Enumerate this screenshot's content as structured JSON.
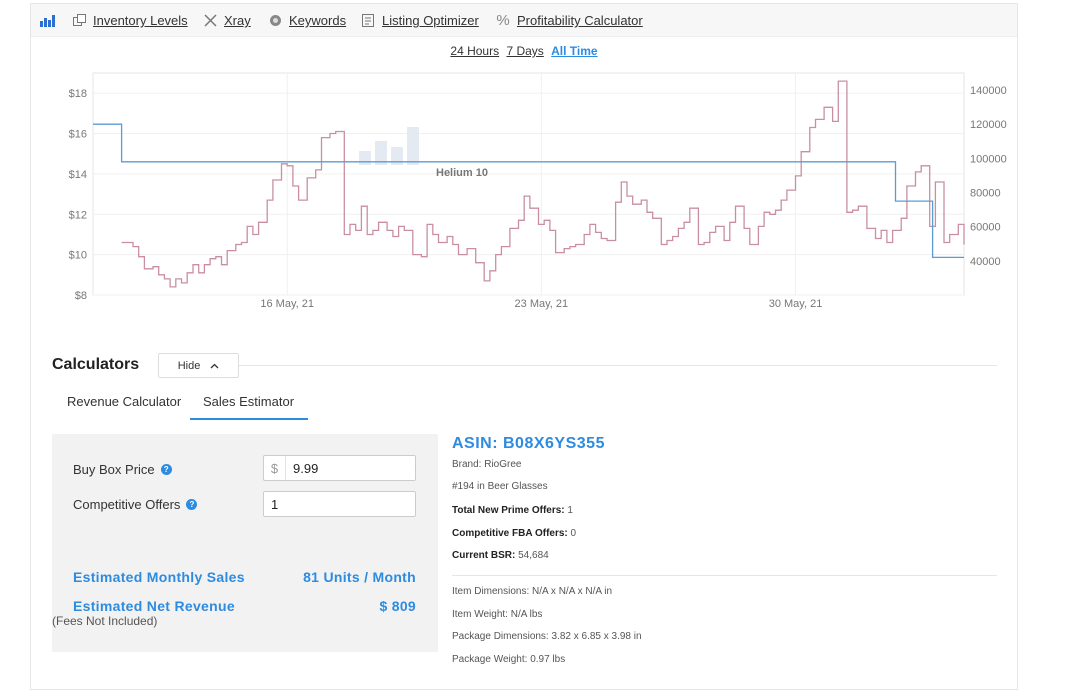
{
  "toolbar": {
    "items": [
      {
        "icon": "bar-chart-icon",
        "label": ""
      },
      {
        "icon": "inventory-icon",
        "label": "Inventory Levels"
      },
      {
        "icon": "xray-icon",
        "label": "Xray"
      },
      {
        "icon": "keywords-icon",
        "label": "Keywords"
      },
      {
        "icon": "listing-optimizer-icon",
        "label": "Listing Optimizer"
      },
      {
        "icon": "percent-icon",
        "label": "Profitability Calculator"
      }
    ]
  },
  "range": {
    "options": [
      "24 Hours",
      "7 Days",
      "All Time"
    ],
    "active": "All Time"
  },
  "chart_data": {
    "type": "line",
    "watermark": "Helium 10",
    "x_ticks": [
      "16 May, 21",
      "23 May, 21",
      "30 May, 21"
    ],
    "y_left_ticks": [
      "$8",
      "$10",
      "$12",
      "$14",
      "$16",
      "$18"
    ],
    "y_right_ticks": [
      "40000",
      "60000",
      "80000",
      "100000",
      "120000",
      "140000"
    ],
    "y_left_range": [
      8,
      19
    ],
    "y_right_range": [
      20000,
      150000
    ],
    "x_range_days": [
      0,
      24.5
    ],
    "series": [
      {
        "axis": "left",
        "color": "#c98fa0",
        "points": [
          [
            1.0,
            10.6
          ],
          [
            1.4,
            10.4
          ],
          [
            1.6,
            9.9
          ],
          [
            1.8,
            9.3
          ],
          [
            2.1,
            9.4
          ],
          [
            2.3,
            9.0
          ],
          [
            2.5,
            8.8
          ],
          [
            2.7,
            8.4
          ],
          [
            2.9,
            8.8
          ],
          [
            3.1,
            8.6
          ],
          [
            3.3,
            9.1
          ],
          [
            3.5,
            9.5
          ],
          [
            3.7,
            9.1
          ],
          [
            3.9,
            9.5
          ],
          [
            4.1,
            9.8
          ],
          [
            4.3,
            9.9
          ],
          [
            4.5,
            9.5
          ],
          [
            4.7,
            10.2
          ],
          [
            5.0,
            10.5
          ],
          [
            5.2,
            10.6
          ],
          [
            5.4,
            11.4
          ],
          [
            5.6,
            11.0
          ],
          [
            5.8,
            11.6
          ],
          [
            6.1,
            12.7
          ],
          [
            6.3,
            13.7
          ],
          [
            6.6,
            14.5
          ],
          [
            6.8,
            14.4
          ],
          [
            7.0,
            13.4
          ],
          [
            7.2,
            12.7
          ],
          [
            7.5,
            13.8
          ],
          [
            7.8,
            14.2
          ],
          [
            8.0,
            15.8
          ],
          [
            8.3,
            16.0
          ],
          [
            8.5,
            16.1
          ],
          [
            8.8,
            11.0
          ],
          [
            9.0,
            11.5
          ],
          [
            9.2,
            11.2
          ],
          [
            9.4,
            12.4
          ],
          [
            9.6,
            11.0
          ],
          [
            9.8,
            11.2
          ],
          [
            10.0,
            11.6
          ],
          [
            10.3,
            11.2
          ],
          [
            10.5,
            10.9
          ],
          [
            10.7,
            11.4
          ],
          [
            10.9,
            11.2
          ],
          [
            11.2,
            10.0
          ],
          [
            11.5,
            9.9
          ],
          [
            11.7,
            11.5
          ],
          [
            11.9,
            11.0
          ],
          [
            12.1,
            10.6
          ],
          [
            12.4,
            10.9
          ],
          [
            12.6,
            10.5
          ],
          [
            12.8,
            10.0
          ],
          [
            13.1,
            10.3
          ],
          [
            13.4,
            9.6
          ],
          [
            13.7,
            8.7
          ],
          [
            13.9,
            9.2
          ],
          [
            14.1,
            10.0
          ],
          [
            14.3,
            10.4
          ],
          [
            14.6,
            11.3
          ],
          [
            14.9,
            11.7
          ],
          [
            15.1,
            12.9
          ],
          [
            15.3,
            12.3
          ],
          [
            15.6,
            11.5
          ],
          [
            15.8,
            11.7
          ],
          [
            16.0,
            11.2
          ],
          [
            16.2,
            10.1
          ],
          [
            16.5,
            10.3
          ],
          [
            16.7,
            10.4
          ],
          [
            16.9,
            10.5
          ],
          [
            17.2,
            11.0
          ],
          [
            17.4,
            11.5
          ],
          [
            17.6,
            11.1
          ],
          [
            17.8,
            10.8
          ],
          [
            18.0,
            10.7
          ],
          [
            18.3,
            12.6
          ],
          [
            18.5,
            13.6
          ],
          [
            18.7,
            12.9
          ],
          [
            18.9,
            12.5
          ],
          [
            19.2,
            12.7
          ],
          [
            19.4,
            12.1
          ],
          [
            19.6,
            11.8
          ],
          [
            19.9,
            10.5
          ],
          [
            20.1,
            10.7
          ],
          [
            20.3,
            10.9
          ],
          [
            20.5,
            11.3
          ],
          [
            20.7,
            11.6
          ],
          [
            20.9,
            12.3
          ],
          [
            21.2,
            10.5
          ],
          [
            21.4,
            10.6
          ],
          [
            21.6,
            11.1
          ],
          [
            21.8,
            11.4
          ],
          [
            22.1,
            10.7
          ],
          [
            22.3,
            11.6
          ],
          [
            22.5,
            12.4
          ],
          [
            22.8,
            11.3
          ],
          [
            23.0,
            10.5
          ],
          [
            23.3,
            11.4
          ],
          [
            23.5,
            12.1
          ],
          [
            23.7,
            12.0
          ],
          [
            23.9,
            12.2
          ],
          [
            24.1,
            12.7
          ],
          [
            24.3,
            13.2
          ],
          [
            24.6,
            13.9
          ],
          [
            24.8,
            15.1
          ],
          [
            25.1,
            16.3
          ],
          [
            25.3,
            16.7
          ],
          [
            25.6,
            17.3
          ],
          [
            25.9,
            16.6
          ],
          [
            26.1,
            18.6
          ],
          [
            26.4,
            12.1
          ],
          [
            26.6,
            12.2
          ],
          [
            26.8,
            12.4
          ],
          [
            27.1,
            11.3
          ],
          [
            27.4,
            10.8
          ],
          [
            27.6,
            11.2
          ],
          [
            27.8,
            10.6
          ],
          [
            28.0,
            11.2
          ],
          [
            28.3,
            11.8
          ],
          [
            28.5,
            13.4
          ],
          [
            28.8,
            14.1
          ],
          [
            29.0,
            14.4
          ],
          [
            29.3,
            11.4
          ],
          [
            29.5,
            13.6
          ],
          [
            29.8,
            10.6
          ],
          [
            30.0,
            11.0
          ],
          [
            30.3,
            11.5
          ],
          [
            30.5,
            10.5
          ]
        ]
      },
      {
        "axis": "right",
        "color": "#5b9bd5",
        "points": [
          [
            0,
            120000
          ],
          [
            1.0,
            98000
          ],
          [
            28.1,
            75000
          ],
          [
            29.4,
            42000
          ],
          [
            30.5,
            42000
          ]
        ]
      }
    ]
  },
  "calculators": {
    "title": "Calculators",
    "hide_label": "Hide",
    "tabs": [
      "Revenue Calculator",
      "Sales Estimator"
    ],
    "active_tab": "Sales Estimator",
    "buy_box_label": "Buy Box Price",
    "buy_box_prefix": "$",
    "buy_box_value": "9.99",
    "offers_label": "Competitive Offers",
    "offers_value": "1",
    "monthly_sales_label": "Estimated Monthly Sales",
    "monthly_sales_value": "81 Units / Month",
    "net_revenue_label": "Estimated Net Revenue",
    "net_revenue_value": "$ 809",
    "fees_note": "(Fees Not Included)"
  },
  "product": {
    "asin": "ASIN: B08X6YS355",
    "brand": "Brand: RioGree",
    "rank": "#194 in Beer Glasses",
    "prime_offers_label": "Total New Prime Offers:",
    "prime_offers_value": " 1",
    "fba_offers_label": "Competitive FBA Offers:",
    "fba_offers_value": " 0",
    "bsr_label": "Current BSR:",
    "bsr_value": " 54,684",
    "item_dims": "Item Dimensions: N/A x N/A x N/A in",
    "item_weight": "Item Weight: N/A lbs",
    "package_dims": "Package Dimensions: 3.82 x 6.85 x 3.98 in",
    "package_weight": "Package Weight: 0.97 lbs"
  }
}
